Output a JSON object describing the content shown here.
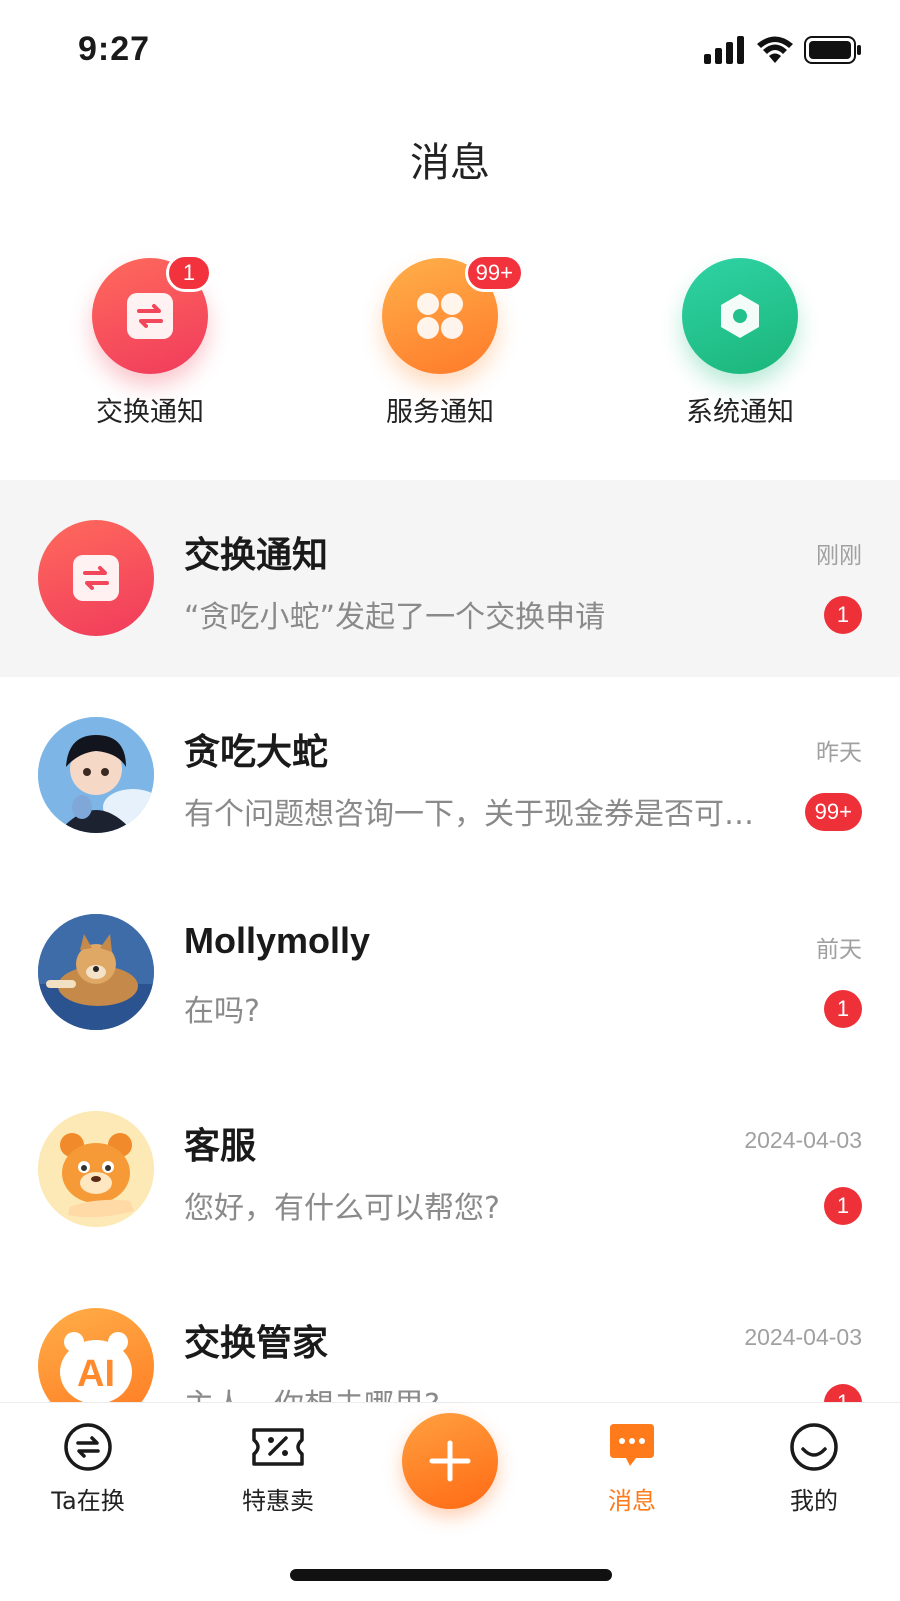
{
  "status_bar": {
    "time": "9:27"
  },
  "header": {
    "title": "消息"
  },
  "shortcuts": [
    {
      "label": "交换通知",
      "badge": "1",
      "icon": "exchange-icon",
      "color": "#f2475a"
    },
    {
      "label": "服务通知",
      "badge": "99+",
      "icon": "grid-icon",
      "color": "#ff8a30"
    },
    {
      "label": "系统通知",
      "badge": "",
      "icon": "settings-hex-icon",
      "color": "#22c08c"
    }
  ],
  "messages": [
    {
      "name": "交换通知",
      "time": "刚刚",
      "preview": "“贪吃小蛇”发起了一个交换申请",
      "unread": "1",
      "avatar": "exchange-icon"
    },
    {
      "name": "贪吃大蛇",
      "time": "昨天",
      "preview": "有个问题想咨询一下，关于现金券是否可以退款",
      "unread": "99+",
      "avatar": "anime-boy-avatar"
    },
    {
      "name": "Mollymolly",
      "time": "前天",
      "preview": "在吗?",
      "unread": "1",
      "avatar": "dog-avatar"
    },
    {
      "name": "客服",
      "time": "2024-04-03",
      "preview": "您好，有什么可以帮您?",
      "unread": "1",
      "avatar": "bear-mascot-avatar"
    },
    {
      "name": "交换管家",
      "time": "2024-04-03",
      "preview": "主人，你想去哪里?",
      "unread": "1",
      "avatar": "ai-bear-avatar"
    }
  ],
  "tab_bar": {
    "tabs": [
      {
        "label": "Ta在换",
        "icon": "exchange-circle-icon"
      },
      {
        "label": "特惠卖",
        "icon": "coupon-icon"
      },
      {
        "label": "",
        "icon": "plus-icon"
      },
      {
        "label": "消息",
        "icon": "chat-bubble-icon",
        "active": true
      },
      {
        "label": "我的",
        "icon": "smile-icon"
      }
    ]
  },
  "colors": {
    "accent": "#ff7a1a",
    "badge_red": "#ee3039",
    "muted_text": "#8a8a8a"
  }
}
